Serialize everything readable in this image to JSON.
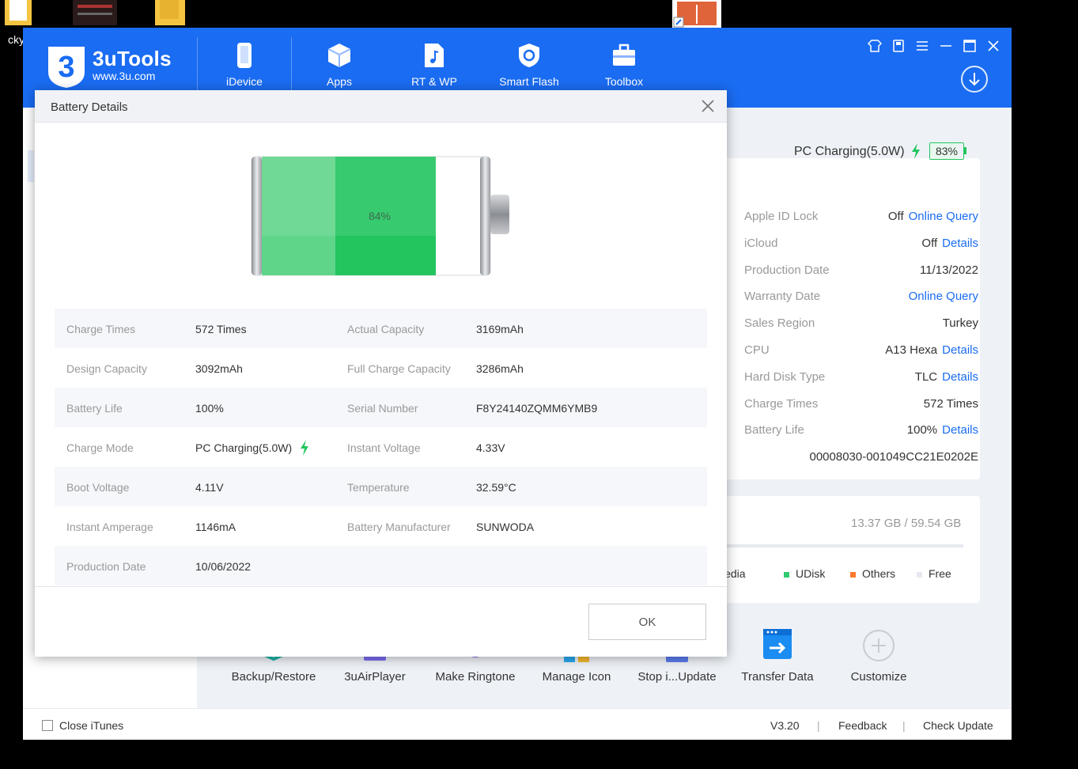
{
  "desktop": {
    "label_fragment": "cky"
  },
  "app": {
    "brand_name": "3uTools",
    "brand_url": "www.3u.com",
    "nav": [
      {
        "label": "iDevice",
        "icon": "phone-icon"
      },
      {
        "label": "Apps",
        "icon": "cube-icon"
      },
      {
        "label": "RT & WP",
        "icon": "music-file-icon"
      },
      {
        "label": "Smart Flash",
        "icon": "shield-refresh-icon"
      },
      {
        "label": "Toolbox",
        "icon": "toolbox-icon"
      }
    ],
    "charging": {
      "text": "PC Charging(5.0W)",
      "percent": "83%",
      "level": 0.83
    },
    "info": [
      {
        "label": "Apple ID Lock",
        "value": "Off",
        "link": "Online Query"
      },
      {
        "label": "iCloud",
        "value": "Off",
        "link": "Details"
      },
      {
        "label": "Production Date",
        "value": "11/13/2022",
        "link": ""
      },
      {
        "label": "Warranty Date",
        "value": "",
        "link": "Online Query"
      },
      {
        "label": "Sales Region",
        "value": "Turkey",
        "link": ""
      },
      {
        "label": "CPU",
        "value": "A13 Hexa",
        "link": "Details"
      },
      {
        "label": "Hard Disk Type",
        "value": "TLC",
        "link": "Details"
      },
      {
        "label": "Charge Times",
        "value": "572 Times",
        "link": ""
      },
      {
        "label": "Battery Life",
        "value": "100%",
        "link": "Details"
      },
      {
        "label": "",
        "value": "00008030-001049CC21E0202E",
        "link": ""
      }
    ],
    "storage": {
      "text": "13.37 GB / 59.54 GB",
      "legend": [
        {
          "label": "ledia",
          "color": "#ffffff"
        },
        {
          "label": "UDisk",
          "color": "#2ecc71"
        },
        {
          "label": "Others",
          "color": "#ff7a2f"
        },
        {
          "label": "Free",
          "color": "#e6e9ef"
        }
      ]
    },
    "tools": [
      {
        "label": "Backup/Restore",
        "icon": "backup-icon"
      },
      {
        "label": "3uAirPlayer",
        "icon": "airplayer-icon"
      },
      {
        "label": "Make Ringtone",
        "icon": "ringtone-icon"
      },
      {
        "label": "Manage Icon",
        "icon": "manage-icon-icon"
      },
      {
        "label": "Stop i...Update",
        "icon": "stop-update-icon"
      },
      {
        "label": "Transfer Data",
        "icon": "transfer-icon"
      },
      {
        "label": "Customize",
        "icon": "plus-circle-icon"
      }
    ],
    "status": {
      "close_itunes": "Close iTunes",
      "version": "V3.20",
      "feedback": "Feedback",
      "check_update": "Check Update",
      "separator": "|"
    }
  },
  "modal": {
    "title": "Battery Details",
    "battery_percent": "84%",
    "battery_level": 0.84,
    "rows": [
      {
        "k1": "Charge Times",
        "v1": "572 Times",
        "k2": "Actual Capacity",
        "v2": "3169mAh"
      },
      {
        "k1": "Design Capacity",
        "v1": "3092mAh",
        "k2": "Full Charge Capacity",
        "v2": "3286mAh"
      },
      {
        "k1": "Battery Life",
        "v1": "100%",
        "k2": "Serial Number",
        "v2": "F8Y24140ZQMM6YMB9"
      },
      {
        "k1": "Charge Mode",
        "v1": "PC Charging(5.0W)",
        "k2": "Instant Voltage",
        "v2": "4.33V"
      },
      {
        "k1": "Boot Voltage",
        "v1": "4.11V",
        "k2": "Temperature",
        "v2": "32.59°C"
      },
      {
        "k1": "Instant Amperage",
        "v1": "1146mA",
        "k2": "Battery Manufacturer",
        "v2": "SUNWODA"
      },
      {
        "k1": "Production Date",
        "v1": "10/06/2022",
        "k2": "",
        "v2": ""
      }
    ],
    "ok_label": "OK"
  },
  "colors": {
    "accent": "#1a6cf2",
    "battery_green": "#22c55e",
    "link": "#1a6cf2"
  }
}
